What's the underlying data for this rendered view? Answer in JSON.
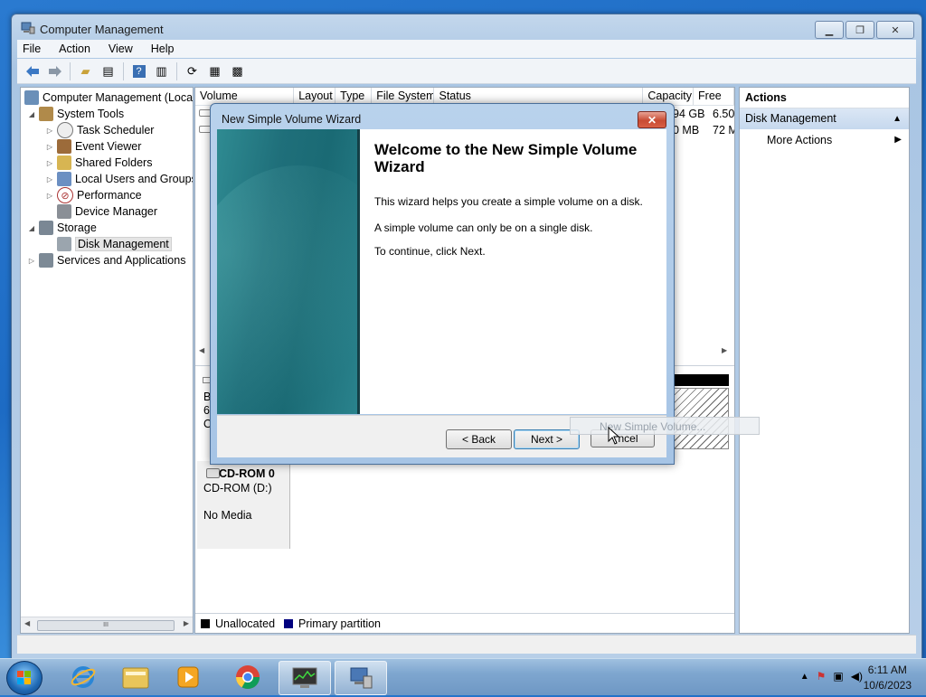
{
  "window": {
    "title": "Computer Management"
  },
  "menu": [
    "File",
    "Action",
    "View",
    "Help"
  ],
  "tree": {
    "items": [
      "Computer Management (Local",
      "System Tools",
      "Task Scheduler",
      "Event Viewer",
      "Shared Folders",
      "Local Users and Groups",
      "Performance",
      "Device Manager",
      "Storage",
      "Disk Management",
      "Services and Applications"
    ],
    "scroll_glyph": "III"
  },
  "volume_table": {
    "columns": [
      "Volume",
      "Layout",
      "Type",
      "File System",
      "Status",
      "Capacity",
      "Free"
    ],
    "rows": [
      {
        "capacity": "94 GB",
        "free": "6.50"
      },
      {
        "capacity": "0 MB",
        "free": "72 M"
      }
    ]
  },
  "disks": {
    "partial_labels": [
      "B",
      "6(",
      "O"
    ],
    "cdrom": {
      "name": "CD-ROM 0",
      "drive": "CD-ROM (D:)",
      "media": "No Media"
    }
  },
  "legend": {
    "items": [
      {
        "label": "Unallocated",
        "color": "#000000"
      },
      {
        "label": "Primary partition",
        "color": "#00007f"
      }
    ]
  },
  "actions": {
    "header": "Actions",
    "section": "Disk Management",
    "items": [
      "More Actions"
    ]
  },
  "wizard": {
    "title": "New Simple Volume Wizard",
    "heading": "Welcome to the New Simple Volume Wizard",
    "paragraphs": [
      "This wizard helps you create a simple volume on a disk.",
      "A simple volume can only be on a single disk.",
      "To continue, click Next."
    ],
    "buttons": {
      "back": "< Back",
      "next": "Next >",
      "cancel": "ncel"
    }
  },
  "drag_ghost": "New Simple Volume...",
  "taskbar": {
    "time": "6:11 AM",
    "date": "10/6/2023"
  },
  "colors": {
    "wizard_panel": "#1f6f7a",
    "close_red": "#c84b33",
    "selection": "#c6d8ee"
  }
}
